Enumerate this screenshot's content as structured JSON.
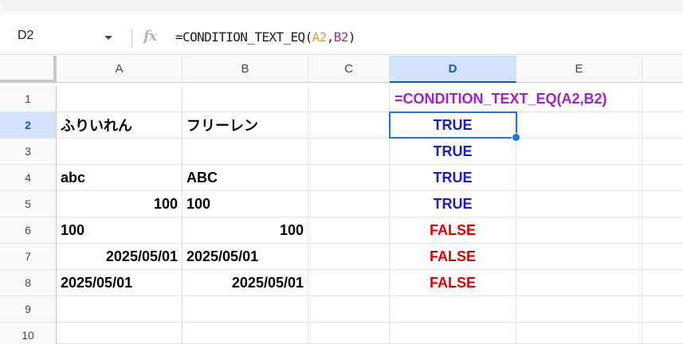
{
  "formula_bar": {
    "name_box": "D2",
    "fx_icon": "fx-icon",
    "formula_prefix": "=CONDITION_TEXT_EQ(",
    "formula_ref_a": "A2",
    "formula_sep": ",",
    "formula_ref_b": "B2",
    "formula_suffix": ")"
  },
  "colors": {
    "accent": "#0b57d0",
    "true_text": "#1a1ad0",
    "false_text": "#e00000",
    "formula_text": "#a020d0",
    "ref_a": "#e69a2e",
    "ref_b": "#9334a8"
  },
  "columns": [
    "A",
    "B",
    "C",
    "D",
    "E"
  ],
  "rows": [
    "1",
    "2",
    "3",
    "4",
    "5",
    "6",
    "7",
    "8",
    "9",
    "10"
  ],
  "selected_cell": "D2",
  "cells": {
    "D1": "=CONDITION_TEXT_EQ(A2,B2)",
    "A2": "ふりいれん",
    "B2": "フリーレン",
    "D2": "TRUE",
    "D3": "TRUE",
    "A4": "abc",
    "B4": "ABC",
    "D4": "TRUE",
    "A5": "100",
    "B5": "100",
    "D5": "TRUE",
    "A6": "100",
    "B6": "100",
    "D6": "FALSE",
    "A7": "2025/05/01",
    "B7": "2025/05/01",
    "D7": "FALSE",
    "A8": "2025/05/01",
    "B8": "2025/05/01",
    "D8": "FALSE"
  }
}
